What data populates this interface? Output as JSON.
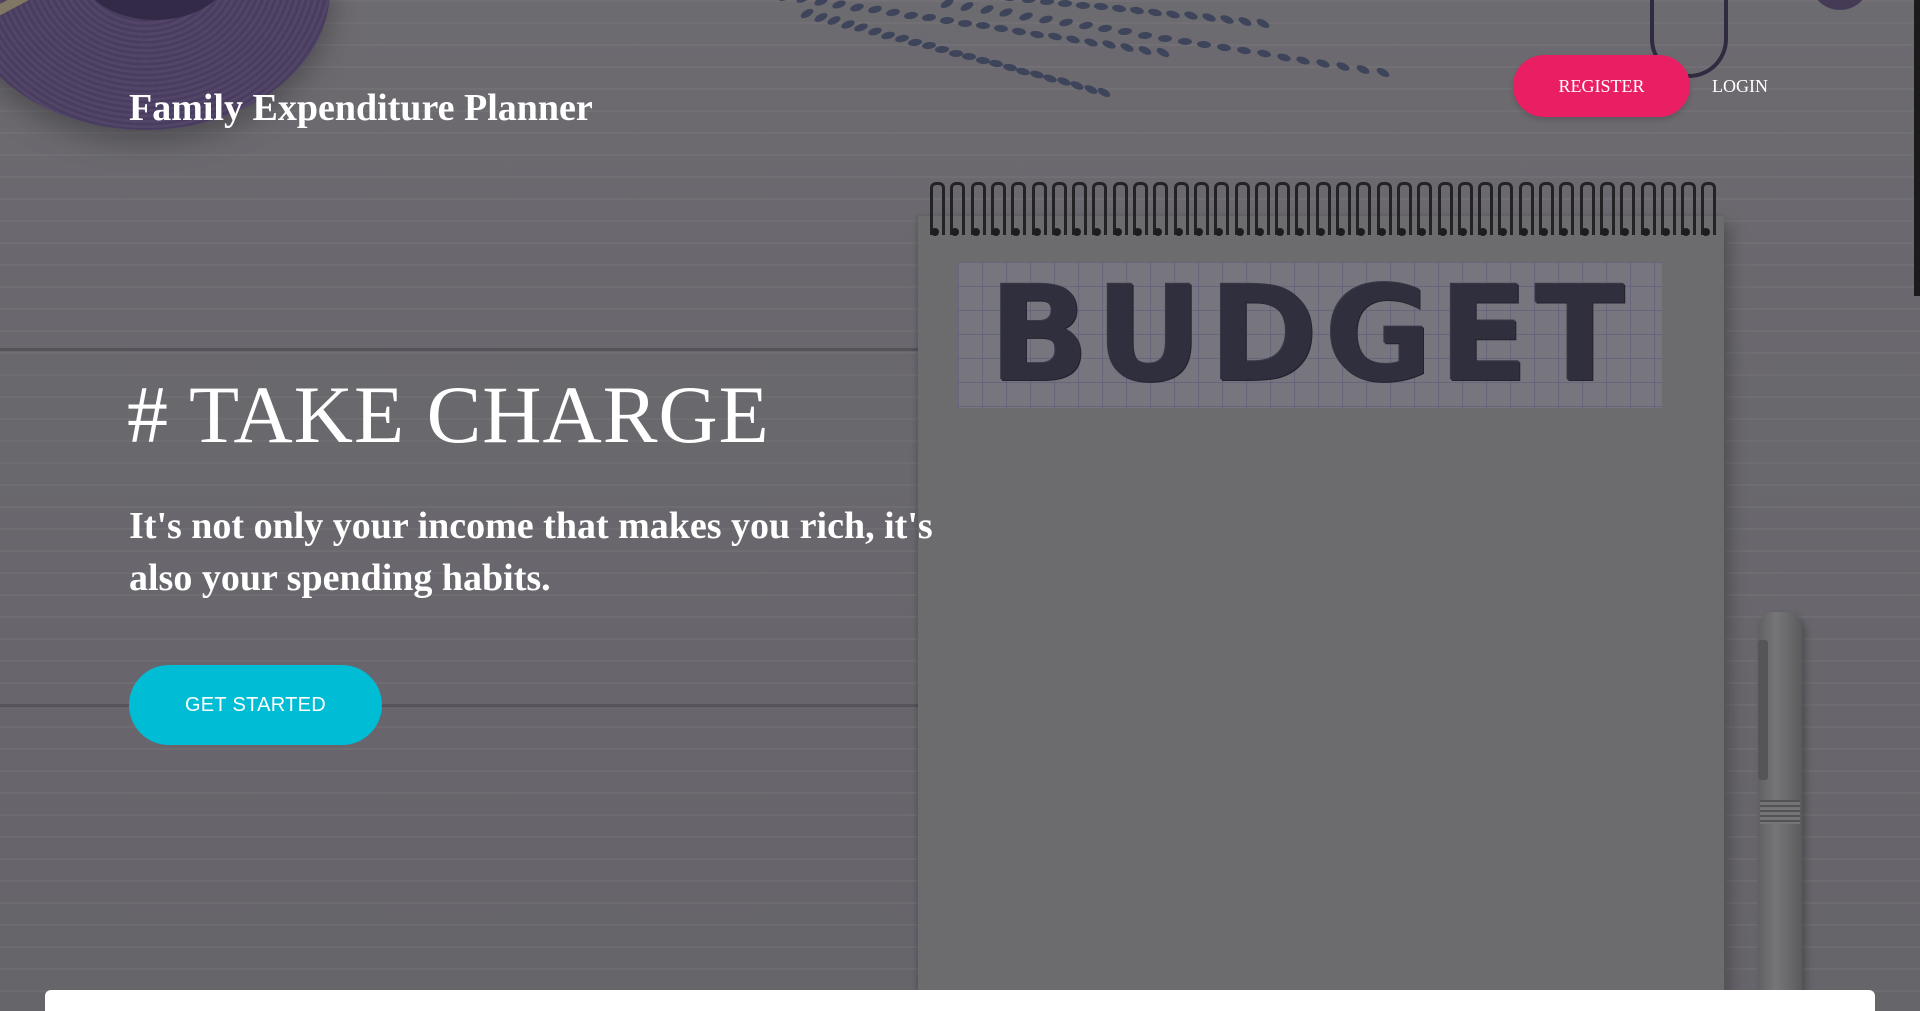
{
  "header": {
    "brand": "Family Expenditure Planner",
    "register_label": "REGISTER",
    "login_label": "LOGIN"
  },
  "hero": {
    "headline": "# TAKE CHARGE",
    "tagline": "It's not only your income that makes you rich, it's also your spending habits.",
    "cta_label": "GET STARTED",
    "notebook_word": "BUDGET"
  },
  "colors": {
    "register_bg": "#e91e63",
    "cta_bg": "#00bcd4",
    "text": "#ffffff"
  }
}
